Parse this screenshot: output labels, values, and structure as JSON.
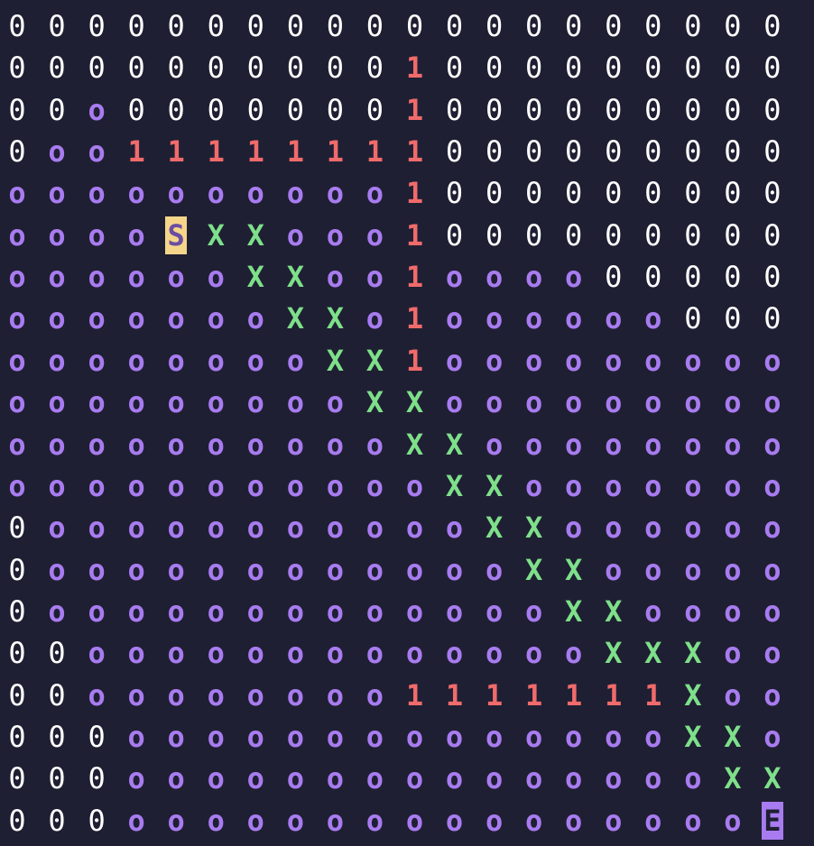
{
  "maze": {
    "rows": [
      "0000000000000000000",
      "0000000000100000000",
      "00o00000001000000000",
      "0oo11111111000000000",
      "oooooooooo1000000000",
      "ooooSXXooo1000000000",
      "ooooooXXoo1oooo00000",
      "oooooooXXo1oooooo000",
      "ooooooooXX1ooooooooo",
      "oooooooooXXooooooooo",
      "ooooooooooXXoooooooo",
      "oooooooooooXXooooooo",
      "0oooooooooooXXoooooo",
      "0ooooooooooooXXooooo",
      "0oooooooooooooXXoooo",
      "00oooooooooooooXXXoo",
      "00oooooooo1111111Xoo",
      "000ooooooooooooooXXo",
      "000oooooooooooooooXX",
      "000ooooooooooooooooE"
    ]
  },
  "colors": {
    "background": "#1f1f33",
    "zero": "#ffffff",
    "visited": "#a87cf0",
    "wall": "#f06b6b",
    "path": "#7ee08a",
    "start_bg": "#f5d58a",
    "end_bg": "#a87cf0"
  }
}
